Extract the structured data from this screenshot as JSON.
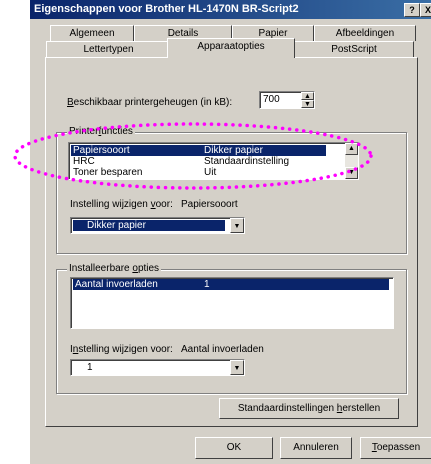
{
  "window": {
    "title": "Eigenschappen voor Brother HL-1470N BR-Script2",
    "help_label": "?",
    "close_label": "X"
  },
  "tabs": {
    "back": [
      {
        "label": "Algemeen"
      },
      {
        "label": "Details"
      },
      {
        "label": "Papier"
      },
      {
        "label": "Afbeeldingen"
      }
    ],
    "front": [
      {
        "label": "Lettertypen"
      },
      {
        "label": "Apparaatopties"
      },
      {
        "label": "PostScript"
      }
    ],
    "active": "Apparaatopties"
  },
  "memory": {
    "label_ul": "B",
    "label_rest": "eschikbaar printergeheugen (in kB):",
    "value": "700"
  },
  "printer_functions": {
    "title_pre": "Printer",
    "title_ul": "f",
    "title_post": "uncties",
    "rows": [
      {
        "name": "Papiersooort",
        "value": "Dikker papier"
      },
      {
        "name": "HRC",
        "value": "Standaardinstelling"
      },
      {
        "name": "Toner besparen",
        "value": "Uit"
      }
    ],
    "change_label_pre": "Instelling wijzigen ",
    "change_label_ul": "v",
    "change_label_post": "oor:",
    "change_target": "Papiersooort",
    "selected_value": "Dikker papier"
  },
  "installable_options": {
    "title_pre": "Installeerbare ",
    "title_ul": "o",
    "title_post": "pties",
    "rows": [
      {
        "name": "Aantal invoerladen",
        "value": "1"
      }
    ],
    "change_label_pre": "I",
    "change_label_ul": "n",
    "change_label_post": "stelling wijzigen voor:",
    "change_target": "Aantal invoerladen",
    "selected_value": "1"
  },
  "buttons": {
    "restore_pre": "Standaardinstellingen ",
    "restore_ul": "h",
    "restore_post": "erstellen",
    "ok": "OK",
    "cancel": "Annuleren",
    "apply_ul": "T",
    "apply_post": "oepassen"
  },
  "colors": {
    "titlebar": "#0a246a",
    "selection": "#0a246a",
    "face": "#d4d0c8",
    "annotation": "#ff00ff"
  }
}
